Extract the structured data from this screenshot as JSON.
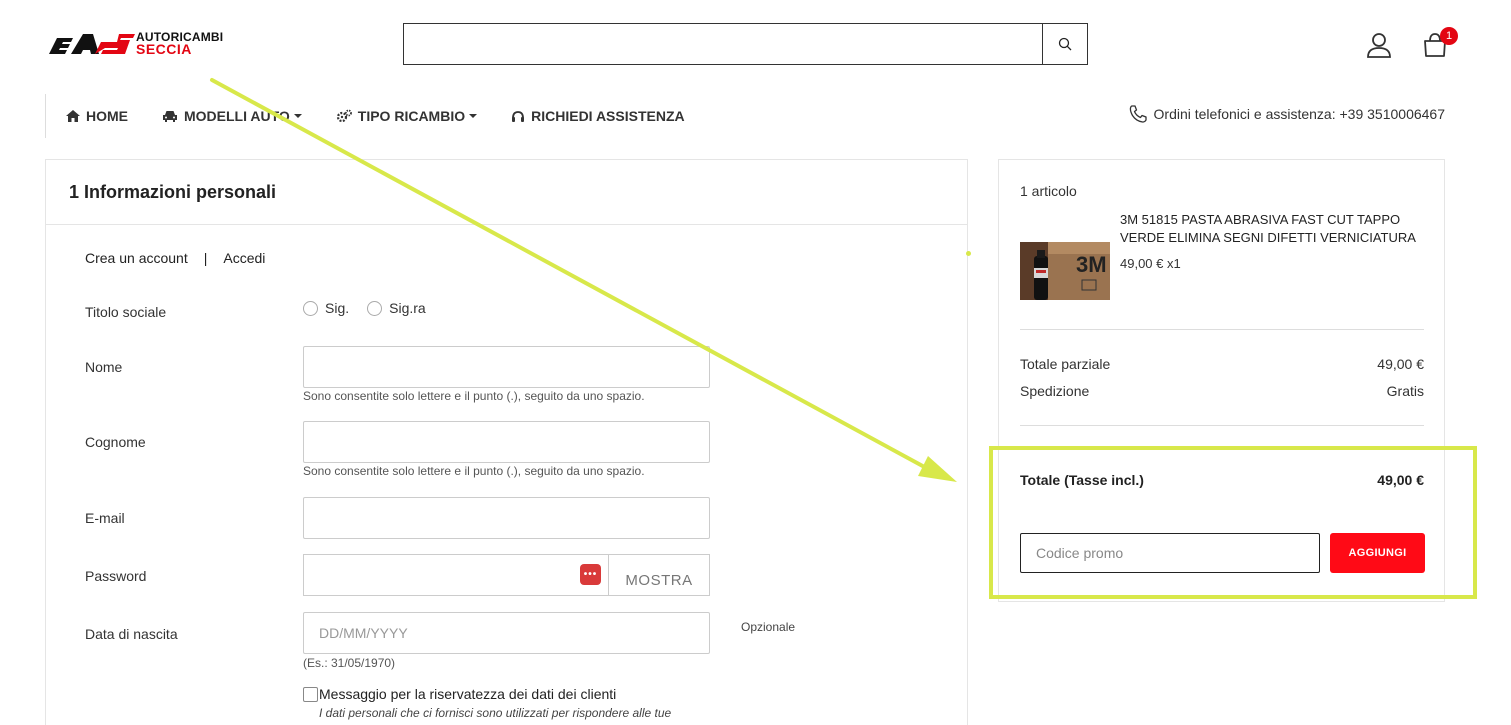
{
  "brand": {
    "line1": "AUTORICAMBI",
    "line2": "SECCIA",
    "colors": {
      "red": "#e30613",
      "black": "#111111"
    }
  },
  "search": {
    "placeholder": ""
  },
  "header": {
    "cart_count": "1"
  },
  "nav": {
    "items": [
      {
        "label": "HOME",
        "icon": "home-icon"
      },
      {
        "label": "MODELLI AUTO",
        "icon": "car-icon"
      },
      {
        "label": "TIPO RICAMBIO",
        "icon": "gears-icon"
      },
      {
        "label": "RICHIEDI ASSISTENZA",
        "icon": "headset-icon"
      }
    ],
    "phone_text": "Ordini telefonici e assistenza: +39 3510006467"
  },
  "checkout": {
    "section_title": "1 Informazioni personali",
    "create_account": "Crea un account",
    "separator": "|",
    "login": "Accedi",
    "labels": {
      "title": "Titolo sociale",
      "first_name": "Nome",
      "last_name": "Cognome",
      "email": "E-mail",
      "password": "Password",
      "birthday": "Data di nascita"
    },
    "radio_options": [
      "Sig.",
      "Sig.ra"
    ],
    "name_hint": "Sono consentite solo lettere e il punto (.), seguito da uno spazio.",
    "password_show": "MOSTRA",
    "birthday_placeholder": "DD/MM/YYYY",
    "birthday_hint": "(Es.: 31/05/1970)",
    "optional": "Opzionale",
    "privacy_label": "Messaggio per la riservatezza dei dati dei clienti",
    "privacy_desc": "I dati personali che ci fornisci sono utilizzati per rispondere alle tue"
  },
  "summary": {
    "items_count": "1 articolo",
    "product_name": "3M 51815 PASTA ABRASIVA FAST CUT TAPPO VERDE ELIMINA SEGNI DIFETTI VERNICIATURA",
    "product_price": "49,00 € x1",
    "subtotal_label": "Totale parziale",
    "subtotal_value": "49,00 €",
    "shipping_label": "Spedizione",
    "shipping_value": "Gratis",
    "total_label": "Totale (Tasse incl.)",
    "total_value": "49,00 €",
    "promo_placeholder": "Codice promo",
    "promo_button": "AGGIUNGI",
    "accent_color": "#ff0a16"
  },
  "annotation": {
    "color": "#d8e84a"
  }
}
